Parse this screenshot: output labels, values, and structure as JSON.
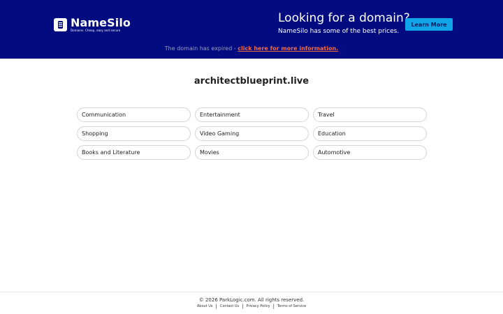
{
  "header": {
    "logo": {
      "name": "NameSilo",
      "tagline": "Domains. Cheap, easy and secure"
    },
    "promo": {
      "title": "Looking for a domain?",
      "subtitle": "NameSilo has some of the best prices."
    },
    "learn_more_label": "Learn More",
    "expired_notice": {
      "text": "The domain has expired - ",
      "link": "click here for more information."
    }
  },
  "main": {
    "domain": "architectblueprint.live",
    "categories": [
      "Communication",
      "Entertainment",
      "Travel",
      "Shopping",
      "Video Gaming",
      "Education",
      "Books and Literature",
      "Movies",
      "Automotive"
    ]
  },
  "footer": {
    "copyright": "© 2026 ParkLogic.com. All rights reserved.",
    "links": [
      "About Us",
      "Contact Us",
      "Privacy Policy",
      "Terms of Service"
    ]
  },
  "colors": {
    "header_bg": "#020b80",
    "button_bg": "#10a4e8",
    "link_accent": "#f26a44"
  }
}
